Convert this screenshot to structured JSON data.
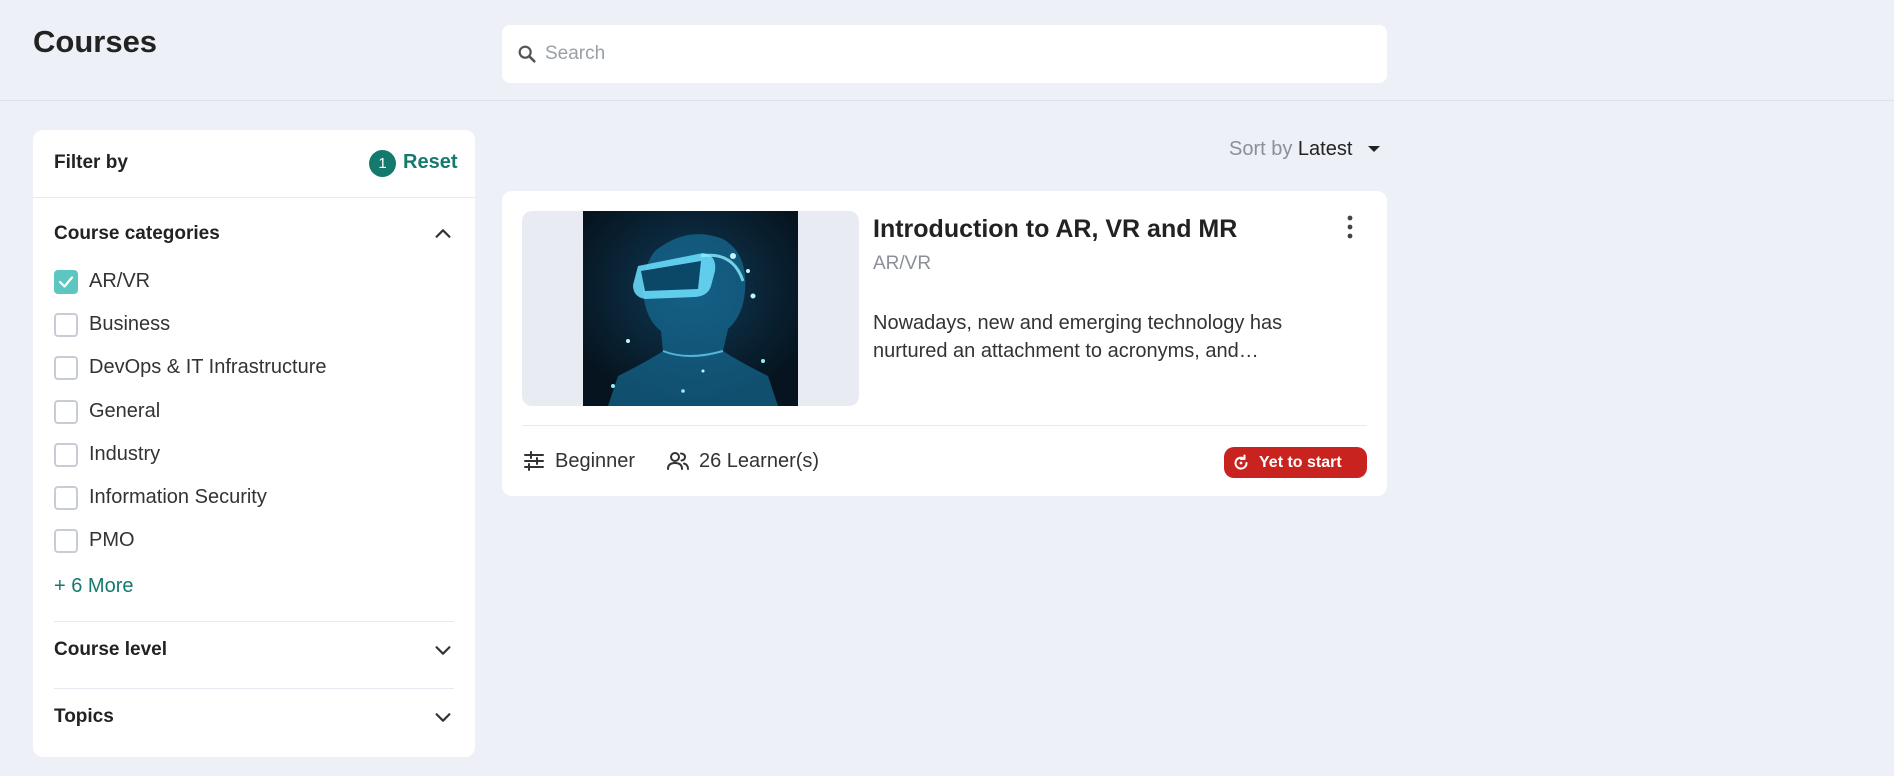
{
  "header": {
    "title": "Courses",
    "search_placeholder": "Search"
  },
  "filter": {
    "title": "Filter by",
    "active_count": "1",
    "reset_label": "Reset",
    "categories": {
      "title": "Course categories",
      "expanded": true,
      "items": [
        {
          "label": "AR/VR",
          "checked": true
        },
        {
          "label": "Business",
          "checked": false
        },
        {
          "label": "DevOps & IT Infrastructure",
          "checked": false
        },
        {
          "label": "General",
          "checked": false
        },
        {
          "label": "Industry",
          "checked": false
        },
        {
          "label": "Information Security",
          "checked": false
        },
        {
          "label": "PMO",
          "checked": false
        }
      ],
      "more_label": "+ 6 More"
    },
    "course_level": {
      "title": "Course level",
      "expanded": false
    },
    "topics": {
      "title": "Topics",
      "expanded": false
    }
  },
  "sort": {
    "prefix": "Sort by",
    "value": "Latest"
  },
  "course": {
    "title": "Introduction to AR, VR and MR",
    "category": "AR/VR",
    "description": "Nowadays, new and emerging technology has nurtured an attachment to acronyms, and…",
    "level": "Beginner",
    "learners": "26 Learner(s)",
    "status": "Yet to start"
  },
  "colors": {
    "accent": "#157a6e",
    "checkbox_checked": "#5cc6c1",
    "status_badge": "#c8231e",
    "background": "#edf0f7"
  }
}
